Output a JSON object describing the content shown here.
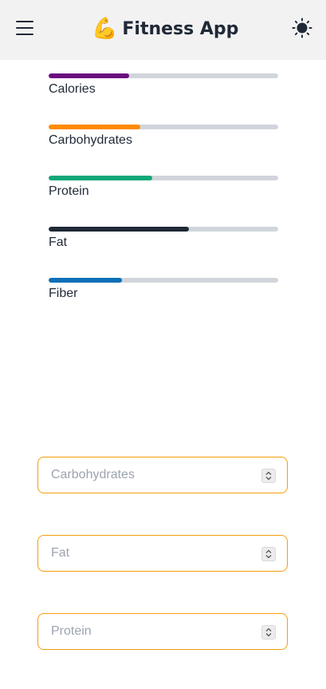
{
  "header": {
    "title": "Fitness App",
    "logo_icon": "flexed-biceps-emoji",
    "menu_icon": "hamburger-icon",
    "theme_icon": "sun-icon"
  },
  "progress_bars": [
    {
      "label": "Calories",
      "percent": 35,
      "color": "#6b0c7f"
    },
    {
      "label": "Carbohydrates",
      "percent": 40,
      "color": "#ff8a00"
    },
    {
      "label": "Protein",
      "percent": 45,
      "color": "#0fa879"
    },
    {
      "label": "Fat",
      "percent": 61,
      "color": "#1f2937"
    },
    {
      "label": "Fiber",
      "percent": 32,
      "color": "#0b6fb9"
    }
  ],
  "form": {
    "fields": [
      {
        "placeholder": "Carbohydrates",
        "value": ""
      },
      {
        "placeholder": "Fat",
        "value": ""
      },
      {
        "placeholder": "Protein",
        "value": ""
      }
    ]
  },
  "colors": {
    "header_bg": "#f2f2f2",
    "track": "#d1d5db",
    "input_border": "#f59e0b"
  }
}
